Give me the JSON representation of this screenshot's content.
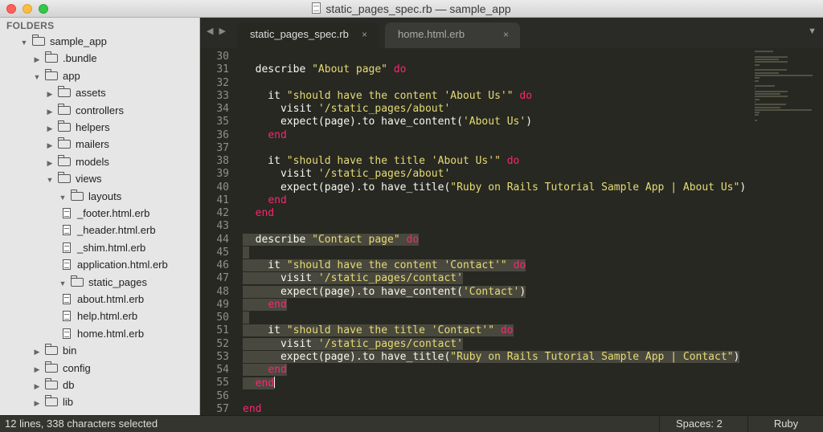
{
  "window": {
    "title": "static_pages_spec.rb — sample_app"
  },
  "sidebar": {
    "header": "FOLDERS",
    "tree": [
      {
        "label": "sample_app",
        "type": "folder",
        "open": true,
        "depth": 0
      },
      {
        "label": ".bundle",
        "type": "folder",
        "open": false,
        "depth": 1
      },
      {
        "label": "app",
        "type": "folder",
        "open": true,
        "depth": 1
      },
      {
        "label": "assets",
        "type": "folder",
        "open": false,
        "depth": 2
      },
      {
        "label": "controllers",
        "type": "folder",
        "open": false,
        "depth": 2
      },
      {
        "label": "helpers",
        "type": "folder",
        "open": false,
        "depth": 2
      },
      {
        "label": "mailers",
        "type": "folder",
        "open": false,
        "depth": 2
      },
      {
        "label": "models",
        "type": "folder",
        "open": false,
        "depth": 2
      },
      {
        "label": "views",
        "type": "folder",
        "open": true,
        "depth": 2
      },
      {
        "label": "layouts",
        "type": "folder",
        "open": true,
        "depth": 3
      },
      {
        "label": "_footer.html.erb",
        "type": "file",
        "depth": 4
      },
      {
        "label": "_header.html.erb",
        "type": "file",
        "depth": 4
      },
      {
        "label": "_shim.html.erb",
        "type": "file",
        "depth": 4
      },
      {
        "label": "application.html.erb",
        "type": "file",
        "depth": 4
      },
      {
        "label": "static_pages",
        "type": "folder",
        "open": true,
        "depth": 3
      },
      {
        "label": "about.html.erb",
        "type": "file",
        "depth": 4
      },
      {
        "label": "help.html.erb",
        "type": "file",
        "depth": 4
      },
      {
        "label": "home.html.erb",
        "type": "file",
        "depth": 4
      },
      {
        "label": "bin",
        "type": "folder",
        "open": false,
        "depth": 1
      },
      {
        "label": "config",
        "type": "folder",
        "open": false,
        "depth": 1
      },
      {
        "label": "db",
        "type": "folder",
        "open": false,
        "depth": 1
      },
      {
        "label": "lib",
        "type": "folder",
        "open": false,
        "depth": 1
      }
    ]
  },
  "tabs": [
    {
      "label": "static_pages_spec.rb",
      "active": true,
      "close": "×"
    },
    {
      "label": "home.html.erb",
      "active": false,
      "close": "×"
    }
  ],
  "tab_nav": {
    "prev": "◀",
    "next": "▶",
    "dropdown": "▼"
  },
  "editor": {
    "lines": [
      {
        "n": "30",
        "tokens": []
      },
      {
        "n": "31",
        "tokens": [
          [
            "t",
            "  describe "
          ],
          [
            "s",
            "\"About page\""
          ],
          [
            "t",
            " "
          ],
          [
            "k",
            "do"
          ]
        ]
      },
      {
        "n": "32",
        "tokens": []
      },
      {
        "n": "33",
        "tokens": [
          [
            "t",
            "    it "
          ],
          [
            "s",
            "\"should have the content 'About Us'\""
          ],
          [
            "t",
            " "
          ],
          [
            "k",
            "do"
          ]
        ]
      },
      {
        "n": "34",
        "tokens": [
          [
            "t",
            "      visit "
          ],
          [
            "s",
            "'/static_pages/about'"
          ]
        ]
      },
      {
        "n": "35",
        "tokens": [
          [
            "t",
            "      expect(page).to have_content("
          ],
          [
            "s",
            "'About Us'"
          ],
          [
            "t",
            ")"
          ]
        ]
      },
      {
        "n": "36",
        "tokens": [
          [
            "t",
            "    "
          ],
          [
            "k",
            "end"
          ]
        ]
      },
      {
        "n": "37",
        "tokens": []
      },
      {
        "n": "38",
        "tokens": [
          [
            "t",
            "    it "
          ],
          [
            "s",
            "\"should have the title 'About Us'\""
          ],
          [
            "t",
            " "
          ],
          [
            "k",
            "do"
          ]
        ]
      },
      {
        "n": "39",
        "tokens": [
          [
            "t",
            "      visit "
          ],
          [
            "s",
            "'/static_pages/about'"
          ]
        ]
      },
      {
        "n": "40",
        "tokens": [
          [
            "t",
            "      expect(page).to have_title("
          ],
          [
            "s",
            "\"Ruby on Rails Tutorial Sample App | About Us\""
          ],
          [
            "t",
            ")"
          ]
        ]
      },
      {
        "n": "41",
        "tokens": [
          [
            "t",
            "    "
          ],
          [
            "k",
            "end"
          ]
        ]
      },
      {
        "n": "42",
        "tokens": [
          [
            "t",
            "  "
          ],
          [
            "k",
            "end"
          ]
        ]
      },
      {
        "n": "43",
        "tokens": []
      },
      {
        "n": "44",
        "sel": true,
        "tokens": [
          [
            "t",
            "  describe "
          ],
          [
            "s",
            "\"Contact page\""
          ],
          [
            "t",
            " "
          ],
          [
            "k",
            "do"
          ]
        ]
      },
      {
        "n": "45",
        "sel": true,
        "tokens": [
          [
            "t",
            " "
          ]
        ]
      },
      {
        "n": "46",
        "sel": true,
        "tokens": [
          [
            "t",
            "    it "
          ],
          [
            "s",
            "\"should have the content 'Contact'\""
          ],
          [
            "t",
            " "
          ],
          [
            "k",
            "do"
          ]
        ]
      },
      {
        "n": "47",
        "sel": true,
        "tokens": [
          [
            "t",
            "      visit "
          ],
          [
            "s",
            "'/static_pages/contact'"
          ]
        ]
      },
      {
        "n": "48",
        "sel": true,
        "tokens": [
          [
            "t",
            "      expect(page).to have_content("
          ],
          [
            "s",
            "'Contact'"
          ],
          [
            "t",
            ")"
          ]
        ]
      },
      {
        "n": "49",
        "sel": true,
        "tokens": [
          [
            "t",
            "    "
          ],
          [
            "k",
            "end"
          ]
        ]
      },
      {
        "n": "50",
        "sel": true,
        "tokens": [
          [
            "t",
            " "
          ]
        ]
      },
      {
        "n": "51",
        "sel": true,
        "tokens": [
          [
            "t",
            "    it "
          ],
          [
            "s",
            "\"should have the title 'Contact'\""
          ],
          [
            "t",
            " "
          ],
          [
            "k",
            "do"
          ]
        ]
      },
      {
        "n": "52",
        "sel": true,
        "tokens": [
          [
            "t",
            "      visit "
          ],
          [
            "s",
            "'/static_pages/contact'"
          ]
        ]
      },
      {
        "n": "53",
        "sel": true,
        "tokens": [
          [
            "t",
            "      expect(page).to have_title("
          ],
          [
            "s",
            "\"Ruby on Rails Tutorial Sample App | Contact\""
          ],
          [
            "t",
            ")"
          ]
        ]
      },
      {
        "n": "54",
        "sel": true,
        "tokens": [
          [
            "t",
            "    "
          ],
          [
            "k",
            "end"
          ]
        ]
      },
      {
        "n": "55",
        "sel": true,
        "cur": true,
        "tokens": [
          [
            "t",
            "  "
          ],
          [
            "k",
            "end"
          ]
        ]
      },
      {
        "n": "56",
        "tokens": []
      },
      {
        "n": "57",
        "tokens": [
          [
            "k",
            "end"
          ]
        ]
      }
    ]
  },
  "status": {
    "selection": "12 lines, 338 characters selected",
    "spaces": "Spaces: 2",
    "syntax": "Ruby"
  }
}
